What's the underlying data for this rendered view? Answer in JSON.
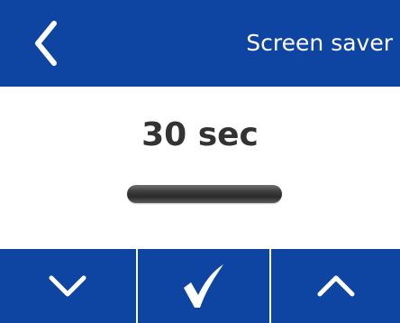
{
  "header": {
    "title": "Screen saver",
    "back_icon": "chevron-left-icon"
  },
  "setting": {
    "value_text": "30 sec"
  },
  "controls": {
    "decrease_icon": "chevron-down-icon",
    "confirm_icon": "checkmark-icon",
    "increase_icon": "chevron-up-icon"
  },
  "colors": {
    "brand_blue": "#0f45a2",
    "background": "#ffffff",
    "value_text": "#333333",
    "icon": "#ffffff"
  }
}
